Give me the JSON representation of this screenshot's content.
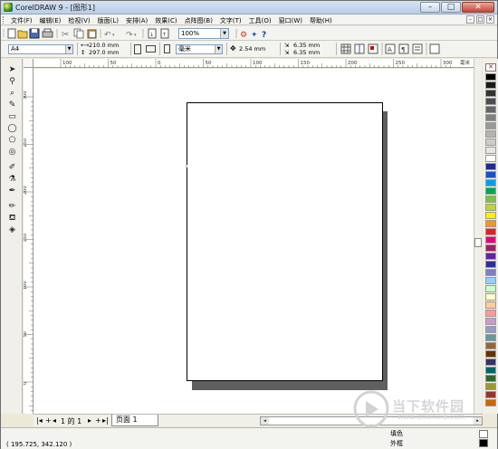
{
  "window": {
    "title": "CorelDRAW 9 - [图形1]",
    "controls": {
      "minimize": "–",
      "maximize": "□",
      "close": "✕"
    }
  },
  "menubar": {
    "items": [
      {
        "label": "文件(F)"
      },
      {
        "label": "编辑(E)"
      },
      {
        "label": "检视(V)"
      },
      {
        "label": "版面(L)"
      },
      {
        "label": "安排(A)"
      },
      {
        "label": "效果(C)"
      },
      {
        "label": "点阵图(B)"
      },
      {
        "label": "文字(T)"
      },
      {
        "label": "工具(O)"
      },
      {
        "label": "窗口(W)"
      },
      {
        "label": "帮助(H)"
      }
    ]
  },
  "toolbar": {
    "zoom": "100%"
  },
  "propbar": {
    "paper_size": "A4",
    "width": "210.0 mm",
    "height": "297.0 mm",
    "units": "毫米",
    "nudge": "2.54 mm",
    "dup_x": "6.35 mm",
    "dup_y": "6.35 mm"
  },
  "rulers": {
    "unit_label": "毫米",
    "h_labels": [
      "100",
      "50",
      "0",
      "50",
      "100",
      "150",
      "200",
      "250",
      "300"
    ],
    "v_labels": [
      "300",
      "250",
      "200",
      "150",
      "100",
      "50",
      "0"
    ]
  },
  "navigator": {
    "page_position": "1 的 1",
    "page_tab": "页面 1"
  },
  "status": {
    "coords": "( 195.725, 342.120 )",
    "fill": "填色",
    "outline": "外框"
  },
  "palette": {
    "colors": [
      "#000000",
      "#1a1a1a",
      "#333333",
      "#4d4d4d",
      "#666666",
      "#808080",
      "#999999",
      "#b3b3b3",
      "#cccccc",
      "#e6e6e6",
      "#ffffff",
      "#1e2b8c",
      "#1d4fbe",
      "#00a0e9",
      "#00a650",
      "#7cc242",
      "#b9d531",
      "#fff200",
      "#f7931e",
      "#ed1c24",
      "#e6007e",
      "#9e1f63",
      "#5f259f",
      "#2e3192",
      "#7f7fbf",
      "#99ccff",
      "#ccffcc",
      "#ffffcc",
      "#ffcc99",
      "#ff9999",
      "#cc99cc",
      "#9999cc",
      "#669999",
      "#996633",
      "#663300",
      "#333366",
      "#006666",
      "#336633",
      "#999933",
      "#993333",
      "#cc6600"
    ]
  },
  "watermark": {
    "name": "当下软件园",
    "url": "www.downxia.com"
  }
}
